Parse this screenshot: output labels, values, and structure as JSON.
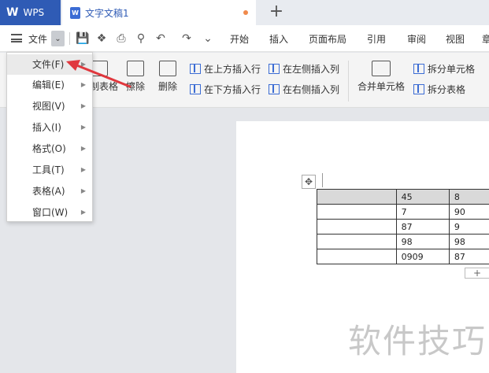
{
  "titlebar": {
    "app_logo": "W",
    "app_name": "WPS",
    "doc_tab_title": "文字文稿1",
    "doc_icon": "W",
    "new_tab": "+"
  },
  "menu_row": {
    "file_label": "文件",
    "tabs": [
      "开始",
      "插入",
      "页面布局",
      "引用",
      "审阅",
      "视图",
      "章"
    ]
  },
  "ribbon": {
    "draw_table": "绘制表格",
    "erase": "擦除",
    "delete": "删除",
    "insert_above": "在上方插入行",
    "insert_below": "在下方插入行",
    "insert_left": "在左侧插入列",
    "insert_right": "在右侧插入列",
    "merge_cells": "合并单元格",
    "split_cells": "拆分单元格",
    "split_table": "拆分表格"
  },
  "dropdown": {
    "items": [
      "文件(F)",
      "编辑(E)",
      "视图(V)",
      "插入(I)",
      "格式(O)",
      "工具(T)",
      "表格(A)",
      "窗口(W)"
    ]
  },
  "table": {
    "rows": [
      [
        "",
        "45",
        "8"
      ],
      [
        "",
        "7",
        "90"
      ],
      [
        "",
        "87",
        "9"
      ],
      [
        "",
        "98",
        "98"
      ],
      [
        "",
        "0909",
        "87"
      ]
    ]
  },
  "watermark": "软件技巧",
  "colors": {
    "brand_blue": "#2f5bb5",
    "arrow_red": "#e0383e"
  }
}
